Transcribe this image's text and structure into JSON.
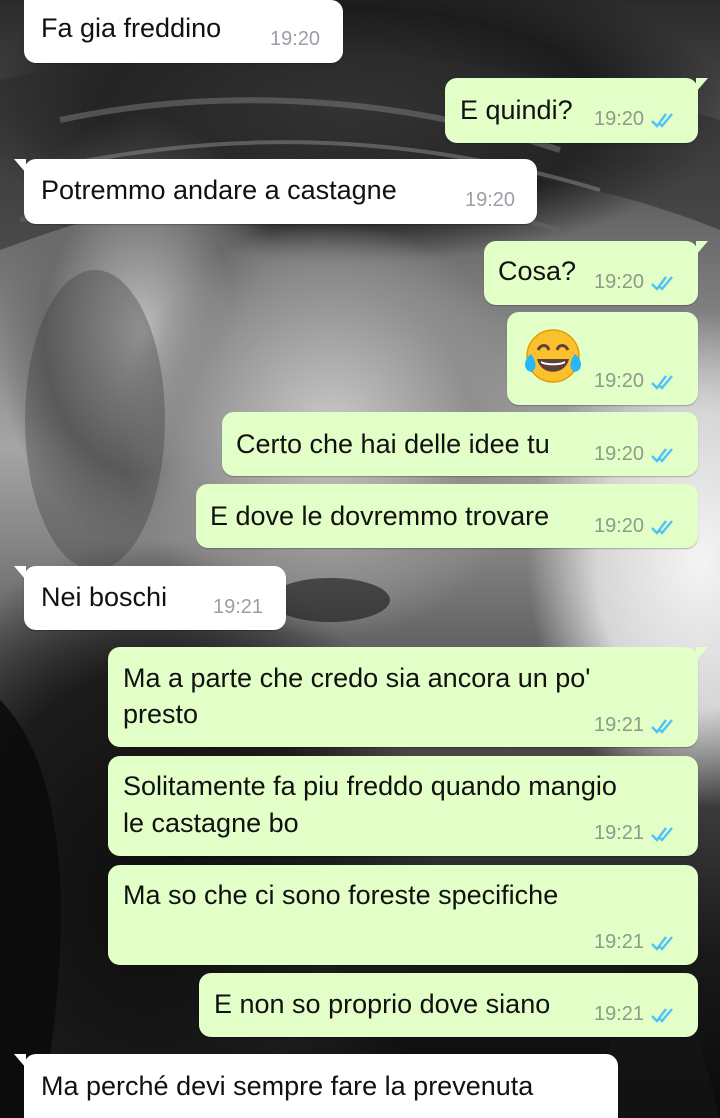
{
  "colors": {
    "incoming_bubble": "#ffffff",
    "outgoing_bubble": "#e1ffc7",
    "timestamp": "#8e9a8a",
    "read_ticks": "#4fc3f7"
  },
  "messages": [
    {
      "direction": "in",
      "text": "Fa gia freddino",
      "time": "19:20"
    },
    {
      "direction": "out",
      "text": "E quindi?",
      "time": "19:20",
      "status": "read"
    },
    {
      "direction": "in",
      "text": "Potremmo andare a castagne",
      "time": "19:20"
    },
    {
      "direction": "out",
      "text": "Cosa?",
      "time": "19:20",
      "status": "read"
    },
    {
      "direction": "out",
      "emoji": "face-with-tears-of-joy",
      "time": "19:20",
      "status": "read"
    },
    {
      "direction": "out",
      "text": "Certo che hai delle idee tu",
      "time": "19:20",
      "status": "read"
    },
    {
      "direction": "out",
      "text": "E dove le dovremmo trovare",
      "time": "19:20",
      "status": "read"
    },
    {
      "direction": "in",
      "text": "Nei boschi",
      "time": "19:21"
    },
    {
      "direction": "out",
      "text_line1": "Ma a parte che credo sia ancora un po'",
      "text_line2": "presto",
      "time": "19:21",
      "status": "read"
    },
    {
      "direction": "out",
      "text_line1": "Solitamente fa piu freddo quando mangio",
      "text_line2": "le castagne bo",
      "time": "19:21",
      "status": "read"
    },
    {
      "direction": "out",
      "text": "Ma so che ci sono foreste specifiche",
      "time": "19:21",
      "status": "read"
    },
    {
      "direction": "out",
      "text": "E non so proprio dove siano",
      "time": "19:21",
      "status": "read"
    },
    {
      "direction": "in",
      "text": "Ma perché devi sempre fare la prevenuta"
    }
  ]
}
